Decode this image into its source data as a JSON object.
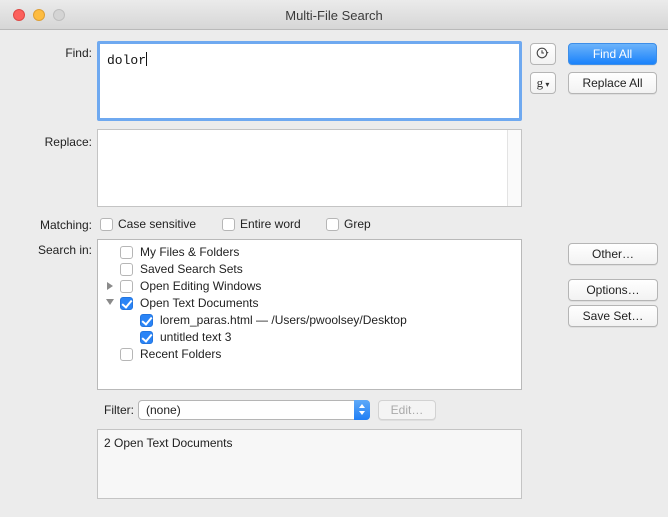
{
  "window": {
    "title": "Multi-File Search"
  },
  "find": {
    "label": "Find:",
    "value": "dolor"
  },
  "replace": {
    "label": "Replace:",
    "value": ""
  },
  "buttons": {
    "find_all": "Find All",
    "replace_all": "Replace All",
    "history_icon": "clock-icon",
    "grep_icon_text": "g",
    "other": "Other…",
    "options": "Options…",
    "save_set": "Save Set…",
    "edit": "Edit…"
  },
  "matching": {
    "label": "Matching:",
    "options": [
      {
        "label": "Case sensitive",
        "checked": false
      },
      {
        "label": "Entire word",
        "checked": false
      },
      {
        "label": "Grep",
        "checked": false
      }
    ]
  },
  "search_in": {
    "label": "Search in:",
    "items": [
      {
        "label": "My Files & Folders",
        "checked": false,
        "level": 0,
        "expander": "none"
      },
      {
        "label": "Saved Search Sets",
        "checked": false,
        "level": 0,
        "expander": "none"
      },
      {
        "label": "Open Editing Windows",
        "checked": false,
        "level": 0,
        "expander": "collapsed"
      },
      {
        "label": "Open Text Documents",
        "checked": true,
        "level": 0,
        "expander": "expanded"
      },
      {
        "label": "lorem_paras.html — /Users/pwoolsey/Desktop",
        "checked": true,
        "level": 1,
        "expander": "none"
      },
      {
        "label": "untitled text 3",
        "checked": true,
        "level": 1,
        "expander": "none"
      },
      {
        "label": "Recent Folders",
        "checked": false,
        "level": 0,
        "expander": "none"
      }
    ]
  },
  "filter": {
    "label": "Filter:",
    "value": "(none)"
  },
  "summary": {
    "text": "2 Open Text Documents"
  },
  "colors": {
    "accent": "#1a82fb",
    "focus_ring": "#6fa9f0",
    "window_bg": "#ececec"
  }
}
